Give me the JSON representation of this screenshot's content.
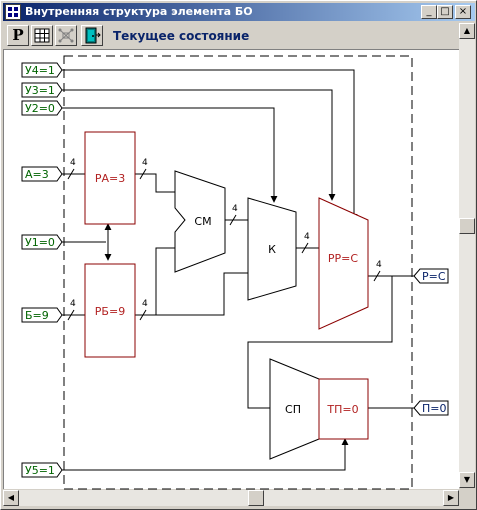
{
  "window": {
    "title": "Внутренняя структура элемента БО",
    "controls": {
      "minimize": "_",
      "maximize": "□",
      "close": "×"
    }
  },
  "toolbar": {
    "state_label": "Текущее состояние",
    "tools": [
      {
        "icon": "registers-icon",
        "label": "P"
      },
      {
        "icon": "grid-icon"
      },
      {
        "icon": "network-icon"
      },
      {
        "icon": "door-exit-icon"
      }
    ]
  },
  "colors": {
    "input_text": "#006400",
    "unit_text": "#b22222",
    "output_text": "#0a246a",
    "window_title_bg": "#0a246a"
  },
  "diagram": {
    "inputs": {
      "u4": "У4=1",
      "u3": "У3=1",
      "u2": "У2=0",
      "a": "А=3",
      "u1": "У1=0",
      "b": "Б=9",
      "u5": "У5=1"
    },
    "outputs": {
      "p": "Р=С",
      "pp": "П=0"
    },
    "units": {
      "ra": "РА=3",
      "rb": "РБ=9",
      "sm": "СМ",
      "k": "К",
      "rr": "РР=С",
      "sp": "СП",
      "tp": "ТП=0"
    },
    "bus_width": "4"
  }
}
